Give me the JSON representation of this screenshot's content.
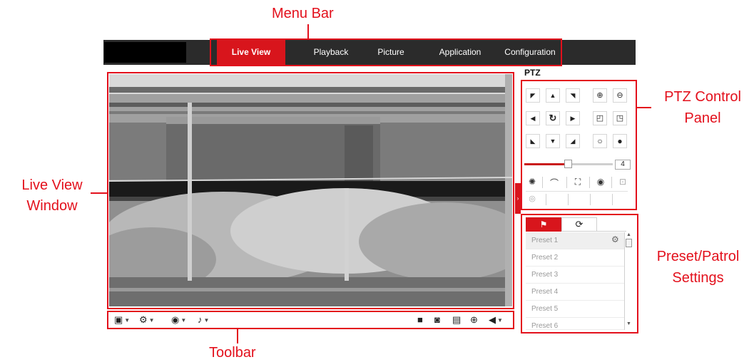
{
  "annotations": {
    "menu_bar": "Menu Bar",
    "live_view_line1": "Live View",
    "live_view_line2": "Window",
    "ptz_line1": "PTZ Control",
    "ptz_line2": "Panel",
    "preset_line1": "Preset/Patrol",
    "preset_line2": "Settings",
    "toolbar": "Toolbar"
  },
  "menu": {
    "items": [
      {
        "label": "Live View",
        "active": true
      },
      {
        "label": "Playback",
        "active": false
      },
      {
        "label": "Picture",
        "active": false
      },
      {
        "label": "Application",
        "active": false
      },
      {
        "label": "Configuration",
        "active": false
      }
    ]
  },
  "ptz": {
    "title": "PTZ",
    "direction_icons": [
      "up-left-arrow-icon",
      "up-arrow-icon",
      "up-right-arrow-icon",
      "left-arrow-icon",
      "auto-rotate-icon",
      "right-arrow-icon",
      "down-left-arrow-icon",
      "down-arrow-icon",
      "down-right-arrow-icon"
    ],
    "speed_value": "4"
  },
  "presets": {
    "items": [
      "Preset 1",
      "Preset 2",
      "Preset 3",
      "Preset 4",
      "Preset 5",
      "Preset 6"
    ]
  },
  "toolbar_icons": [
    "window-layout-icon",
    "stream-type-icon",
    "plugin-icon",
    "microphone-icon",
    "stop-icon",
    "capture-icon",
    "record-icon",
    "digital-zoom-icon",
    "audio-icon"
  ],
  "colors": {
    "accent": "#d8151c",
    "annotation": "#e3101c",
    "menubar_bg": "#2b2b2b"
  }
}
